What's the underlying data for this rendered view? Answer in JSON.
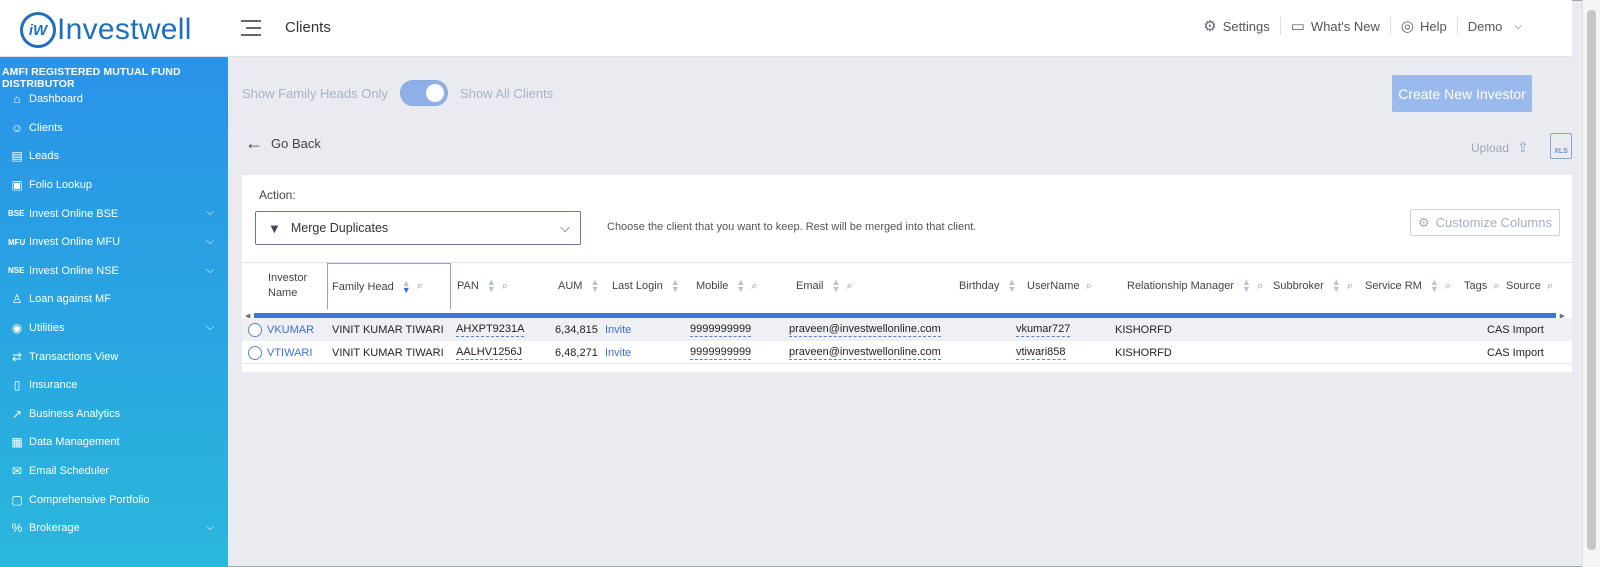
{
  "header": {
    "logo_text": "Investwell",
    "logo_mark": "iW",
    "page_title": "Clients",
    "nav": [
      {
        "icon": "gear-icon",
        "label": "Settings"
      },
      {
        "icon": "chat-icon",
        "label": "What's New"
      },
      {
        "icon": "help-icon",
        "label": "Help"
      },
      {
        "icon": "",
        "label": "Demo"
      }
    ]
  },
  "sidebar": {
    "banner": "AMFI REGISTERED MUTUAL FUND DISTRIBUTOR",
    "items": [
      {
        "label": "Dashboard",
        "icon": "home-icon",
        "prefix": "",
        "has_chevron": false
      },
      {
        "label": "Clients",
        "icon": "users-icon",
        "prefix": "",
        "has_chevron": false
      },
      {
        "label": "Leads",
        "icon": "leads-icon",
        "prefix": "",
        "has_chevron": false
      },
      {
        "label": "Folio Lookup",
        "icon": "folio-lookup-icon",
        "prefix": "",
        "has_chevron": false
      },
      {
        "label": "Invest Online BSE",
        "icon": "",
        "prefix": "BSE",
        "has_chevron": true
      },
      {
        "label": "Invest Online MFU",
        "icon": "",
        "prefix": "MFU",
        "has_chevron": true
      },
      {
        "label": "Invest Online NSE",
        "icon": "",
        "prefix": "NSE",
        "has_chevron": true
      },
      {
        "label": "Loan against MF",
        "icon": "loan-icon",
        "prefix": "",
        "has_chevron": false
      },
      {
        "label": "Utilities",
        "icon": "utilities-icon",
        "prefix": "",
        "has_chevron": true
      },
      {
        "label": "Transactions View",
        "icon": "transactions-icon",
        "prefix": "",
        "has_chevron": false
      },
      {
        "label": "Insurance",
        "icon": "insurance-icon",
        "prefix": "",
        "has_chevron": false
      },
      {
        "label": "Business Analytics",
        "icon": "analytics-icon",
        "prefix": "",
        "has_chevron": false
      },
      {
        "label": "Data Management",
        "icon": "data-icon",
        "prefix": "",
        "has_chevron": false
      },
      {
        "label": "Email Scheduler",
        "icon": "email-icon",
        "prefix": "",
        "has_chevron": false
      },
      {
        "label": "Comprehensive Portfolio",
        "icon": "portfolio-icon",
        "prefix": "",
        "has_chevron": false
      },
      {
        "label": "Brokerage",
        "icon": "brokerage-icon",
        "prefix": "",
        "has_chevron": true
      }
    ]
  },
  "toggle": {
    "left_label": "Show Family Heads Only",
    "right_label": "Show All Clients"
  },
  "create_button": "Create New Investor",
  "go_back": "Go Back",
  "upload_label": "Upload",
  "xls_label": "XLS",
  "action": {
    "label": "Action:",
    "selected": "Merge Duplicates",
    "hint": "Choose the client that you want to keep. Rest will be merged into that client."
  },
  "customize_button": "Customize Columns",
  "table": {
    "columns": [
      "Investor Name",
      "Family Head",
      "PAN",
      "AUM",
      "Last Login",
      "Mobile",
      "Email",
      "Birthday",
      "UserName",
      "Relationship Manager",
      "Subbroker",
      "Service RM",
      "Tags",
      "Source"
    ],
    "rows": [
      {
        "investor_name": "VKUMAR",
        "family_head": "VINIT KUMAR TIWARI",
        "pan": "AHXPT9231A",
        "aum": "6,34,815",
        "last_login": "Invite",
        "mobile": "9999999999",
        "email": "praveen@investwellonline.com",
        "birthday": "",
        "username": "vkumar727",
        "rm": "KISHORFD",
        "subbroker": "",
        "service_rm": "",
        "tags": "",
        "source": "CAS Import"
      },
      {
        "investor_name": "VTIWARI",
        "family_head": "VINIT KUMAR TIWARI",
        "pan": "AALHV1256J",
        "aum": "6,48,271",
        "last_login": "Invite",
        "mobile": "9999999999",
        "email": "praveen@investwellonline.com",
        "birthday": "",
        "username": "vtiwari858",
        "rm": "KISHORFD",
        "subbroker": "",
        "service_rm": "",
        "tags": "",
        "source": "CAS Import"
      }
    ]
  }
}
